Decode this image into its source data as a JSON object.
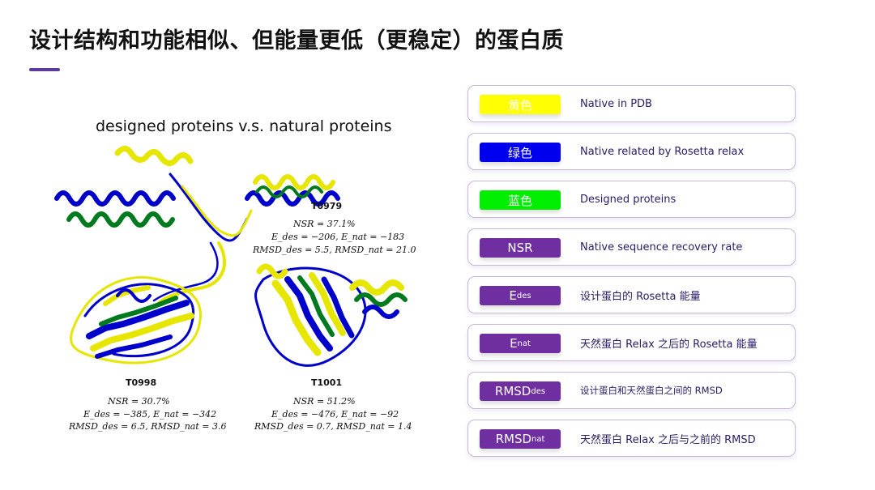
{
  "slide": {
    "title": "设计结构和功能相似、但能量更低（更稳定）的蛋白质"
  },
  "figure": {
    "title": "designed proteins v.s. natural proteins",
    "panels": [
      {
        "id": "T0979",
        "metrics": [
          "NSR = 37.1%",
          "E_des = −206,  E_nat = −183",
          "RMSD_des = 5.5, RMSD_nat = 21.0"
        ]
      },
      {
        "id": "T0998",
        "metrics": [
          "NSR = 30.7%",
          "E_des = −385,  E_nat = −342",
          "RMSD_des = 6.5, RMSD_nat = 3.6"
        ]
      },
      {
        "id": "T1001",
        "metrics": [
          "NSR = 51.2%",
          "E_des = −476,  E_nat = −92",
          "RMSD_des = 0.7, RMSD_nat = 1.4"
        ]
      }
    ]
  },
  "legend": [
    {
      "swatch_label": "黄色",
      "swatch_color": "#ffff00",
      "description": "Native in PDB"
    },
    {
      "swatch_label": "绿色",
      "swatch_color": "#0000ee",
      "description": "Native related by Rosetta relax"
    },
    {
      "swatch_label": "蓝色",
      "swatch_color": "#00ee00",
      "description": "Designed proteins"
    },
    {
      "swatch_label": "NSR",
      "swatch_color": "#6f2fa0",
      "description": "Native sequence recovery rate"
    },
    {
      "swatch_label": "E",
      "swatch_sub": "des",
      "swatch_color": "#6f2fa0",
      "description": "设计蛋白的 Rosetta 能量"
    },
    {
      "swatch_label": "E",
      "swatch_sub": "nat",
      "swatch_color": "#6f2fa0",
      "description": "天然蛋白 Relax 之后的 Rosetta 能量"
    },
    {
      "swatch_label": "RMSD",
      "swatch_sub": "des",
      "swatch_color": "#6f2fa0",
      "description": "设计蛋白和天然蛋白之间的 RMSD"
    },
    {
      "swatch_label": "RMSD",
      "swatch_sub": "nat",
      "swatch_color": "#6f2fa0",
      "description": "天然蛋白 Relax 之后与之前的 RMSD"
    }
  ],
  "colors": {
    "accent": "#5b3a9b",
    "protein_yellow": "#ffff00",
    "protein_blue": "#0000cc",
    "protein_green": "#007a1e"
  }
}
